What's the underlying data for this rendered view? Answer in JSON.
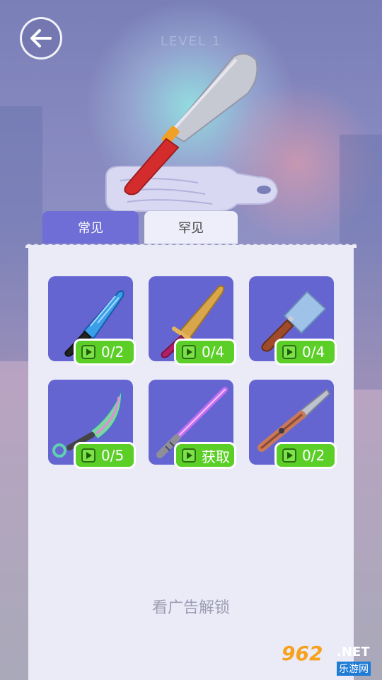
{
  "header": {
    "level_label": "LEVEL 1"
  },
  "tabs": [
    {
      "label": "常见"
    },
    {
      "label": "罕见"
    }
  ],
  "knives": [
    {
      "name": "blue-combat-knife-icon",
      "progress": "0/2"
    },
    {
      "name": "golden-dagger-icon",
      "progress": "0/4"
    },
    {
      "name": "cleaver-icon",
      "progress": "0/4"
    },
    {
      "name": "rainbow-karambit-icon",
      "progress": "0/5"
    },
    {
      "name": "purple-lightsaber-icon",
      "progress": "获取"
    },
    {
      "name": "folding-knife-icon",
      "progress": "0/2"
    }
  ],
  "footer": {
    "unlock_text": "看广告解锁"
  },
  "watermark": {
    "number": "962",
    "suffix": ".NET",
    "site": "乐游网"
  },
  "colors": {
    "tab_active": "#6f6ed6",
    "card_bg": "#6565d2",
    "badge_green": "#5bcf27",
    "panel_bg": "#ebebf8"
  }
}
